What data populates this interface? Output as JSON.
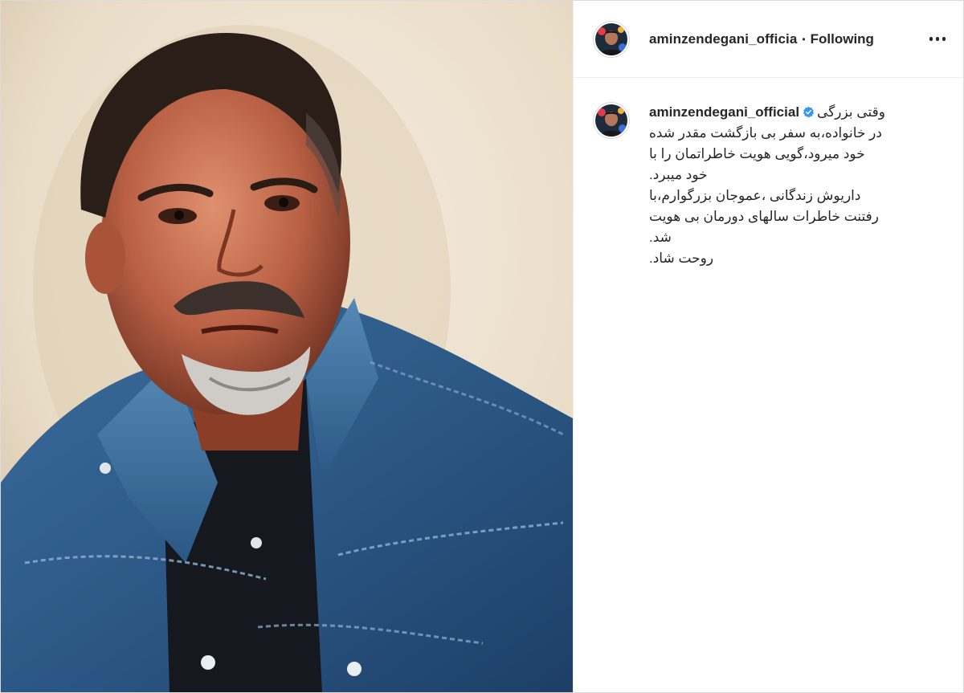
{
  "post": {
    "photo_alt": "portrait photo",
    "header": {
      "username": "aminzendegani_officia",
      "separator": "•",
      "follow_status": "Following",
      "more_icon": "more-horizontal-icon"
    },
    "caption": {
      "username": "aminzendegani_official",
      "verified_icon": "verified-badge-icon",
      "first_line_text": "وقتی بزرگی",
      "lines": [
        "در خانواده،به سفر بی بازگشت مقدر شده",
        "خود میرود،گویی هویت خاطراتمان را با",
        ".خود میبرد",
        "داریوش زندگانی ،عموجان بزرگوارم،با",
        "رفتنت خاطرات سالهای دورمان بی هویت",
        ".شد",
        ".روحت شاد"
      ]
    },
    "colors": {
      "verified_blue": "#3897f0",
      "text": "#262626",
      "border": "#efefef"
    }
  }
}
